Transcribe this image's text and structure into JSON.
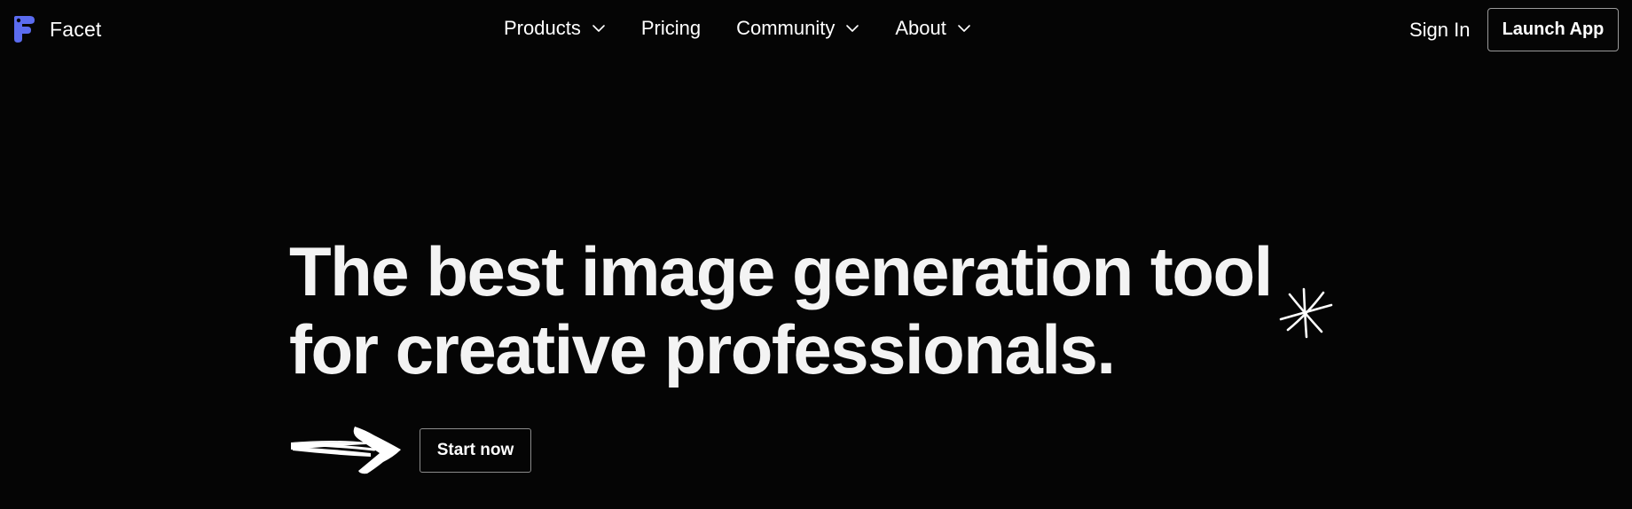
{
  "brand": {
    "name": "Facet",
    "logo_icon": "facet-logo-icon",
    "logo_color": "#5b6cf0"
  },
  "nav": {
    "items": [
      {
        "label": "Products",
        "icon": "chevron-down-icon"
      },
      {
        "label": "Pricing"
      },
      {
        "label": "Community",
        "icon": "chevron-down-icon"
      },
      {
        "label": "About",
        "icon": "chevron-down-icon"
      }
    ],
    "sign_in": "Sign In",
    "launch_app": "Launch App"
  },
  "hero": {
    "headline_line1": "The best image generation tool",
    "headline_line2": "for creative professionals.",
    "cta": "Start now",
    "decorations": [
      "sparkle-icon",
      "brush-arrow-icon"
    ]
  },
  "colors": {
    "background": "#050505",
    "text": "#f3f3f3",
    "button_border": "#9a9a9a"
  }
}
